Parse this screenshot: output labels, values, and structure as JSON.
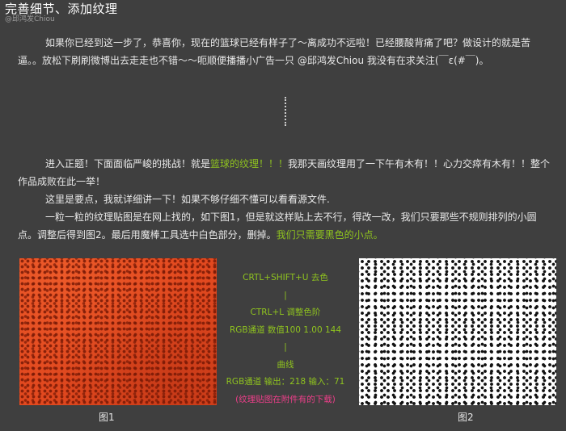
{
  "header": {
    "title": "完善细节、添加纹理",
    "watermark": "@邱鸿发Chiou"
  },
  "paragraphs": {
    "p1": "如果你已经到这一步了，恭喜你，现在的篮球已经有样子了～离成功不远啦！已经腰酸背痛了吧？做设计的就是苦逼。。放松下刷刷微博出去走走也不错～～呃顺便播播小广告一只 @邱鸿发Chiou 我没有在求关注(￣ε(#￣)。",
    "p2_before": "进入正题！下面面临严峻的挑战！就是",
    "p2_highlight": "篮球的纹理！！！",
    "p2_after": "我那天画纹理用了一下午有木有！！心力交瘁有木有！！整个作品成败在此一举！",
    "p3": "这里是要点，我就详细讲一下！如果不够仔细不懂可以看看源文件.",
    "p4_before": "一粒一粒的纹理贴图是在网上找的，如下图1，但是就这样贴上去不行，得改一改，我们只要那些不规则排列的小圆点。调整后得到图2。最后用魔棒工具选中白色部分，删掉。",
    "p4_highlight": "我们只需要黑色的小点。"
  },
  "steps": [
    "CRTL+SHIFT+U 去色",
    "|",
    "CTRL+L 调整色阶",
    "RGB通道 数值100 1.00 144",
    "|",
    "曲线",
    "RGB通道 输出：218 输入：71"
  ],
  "steps_note": "(纹理贴图在附件有的下载)",
  "figures": {
    "fig1_caption": "图1",
    "fig2_caption": "图2"
  },
  "colors": {
    "background": "#3f3f3f",
    "highlight_green": "#8fc31f",
    "note_pink": "#ee3f8a",
    "texture_orange": "#e2491f"
  }
}
